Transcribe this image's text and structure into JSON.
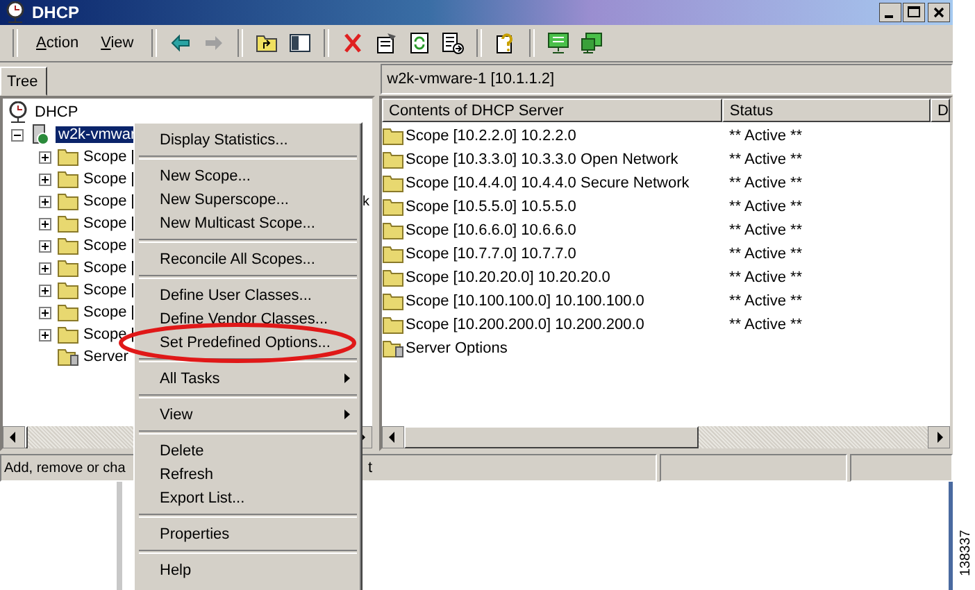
{
  "window": {
    "title": "DHCP"
  },
  "menu_bar": [
    "Action",
    "View"
  ],
  "tree_tab": "Tree",
  "tree": [
    {
      "label": "DHCP",
      "kind": "dhcp",
      "children": [
        {
          "label": "w2k-vmwar",
          "kind": "server",
          "expanded": true,
          "selected": true,
          "children": [
            {
              "label": "Scope [",
              "kind": "scope",
              "expanded": false
            },
            {
              "label": "Scope [",
              "kind": "scope",
              "expanded": false
            },
            {
              "label": "Scope [",
              "kind": "scope",
              "expanded": false,
              "tail": "k"
            },
            {
              "label": "Scope [",
              "kind": "scope",
              "expanded": false
            },
            {
              "label": "Scope [",
              "kind": "scope",
              "expanded": false
            },
            {
              "label": "Scope [",
              "kind": "scope",
              "expanded": false
            },
            {
              "label": "Scope [",
              "kind": "scope",
              "expanded": false
            },
            {
              "label": "Scope [",
              "kind": "scope",
              "expanded": false
            },
            {
              "label": "Scope [",
              "kind": "scope",
              "expanded": false
            },
            {
              "label": "Server",
              "kind": "options"
            }
          ]
        }
      ]
    }
  ],
  "server_header": "w2k-vmware-1 [10.1.1.2]",
  "list": {
    "columns": [
      "Contents of DHCP Server",
      "Status",
      "D"
    ],
    "rows": [
      {
        "name": "Scope [10.2.2.0] 10.2.2.0",
        "status": "** Active **",
        "kind": "scope"
      },
      {
        "name": "Scope [10.3.3.0] 10.3.3.0 Open Network",
        "status": "** Active **",
        "kind": "scope"
      },
      {
        "name": "Scope [10.4.4.0] 10.4.4.0 Secure Network",
        "status": "** Active **",
        "kind": "scope"
      },
      {
        "name": "Scope [10.5.5.0] 10.5.5.0",
        "status": "** Active **",
        "kind": "scope"
      },
      {
        "name": "Scope [10.6.6.0] 10.6.6.0",
        "status": "** Active **",
        "kind": "scope"
      },
      {
        "name": "Scope [10.7.7.0] 10.7.7.0",
        "status": "** Active **",
        "kind": "scope"
      },
      {
        "name": "Scope [10.20.20.0] 10.20.20.0",
        "status": "** Active **",
        "kind": "scope"
      },
      {
        "name": "Scope [10.100.100.0] 10.100.100.0",
        "status": "** Active **",
        "kind": "scope"
      },
      {
        "name": "Scope [10.200.200.0] 10.200.200.0",
        "status": "** Active **",
        "kind": "scope"
      },
      {
        "name": "Server Options",
        "kind": "options"
      }
    ]
  },
  "status_bar": {
    "text": "Add, remove or cha",
    "tail": "t"
  },
  "context_menu": {
    "items": [
      {
        "kind": "item",
        "label": "Display Statistics...",
        "circled": false
      },
      {
        "kind": "separator"
      },
      {
        "kind": "item",
        "label": "New Scope...",
        "circled": false
      },
      {
        "kind": "item",
        "label": "New Superscope...",
        "circled": false
      },
      {
        "kind": "item",
        "label": "New Multicast Scope...",
        "circled": false
      },
      {
        "kind": "separator"
      },
      {
        "kind": "item",
        "label": "Reconcile All Scopes...",
        "circled": false
      },
      {
        "kind": "separator"
      },
      {
        "kind": "item",
        "label": "Define User Classes...",
        "circled": false
      },
      {
        "kind": "item",
        "label": "Define Vendor Classes...",
        "circled": false
      },
      {
        "kind": "item",
        "label": "Set Predefined Options...",
        "circled": true
      },
      {
        "kind": "separator"
      },
      {
        "kind": "submenu",
        "label": "All Tasks",
        "circled": false
      },
      {
        "kind": "separator"
      },
      {
        "kind": "submenu",
        "label": "View",
        "circled": false
      },
      {
        "kind": "separator"
      },
      {
        "kind": "item",
        "label": "Delete",
        "circled": false
      },
      {
        "kind": "item",
        "label": "Refresh",
        "circled": false
      },
      {
        "kind": "item",
        "label": "Export List...",
        "circled": false
      },
      {
        "kind": "separator"
      },
      {
        "kind": "item",
        "label": "Properties",
        "circled": false
      },
      {
        "kind": "separator"
      },
      {
        "kind": "item",
        "label": "Help",
        "circled": false
      }
    ]
  },
  "figure_number": "138337"
}
